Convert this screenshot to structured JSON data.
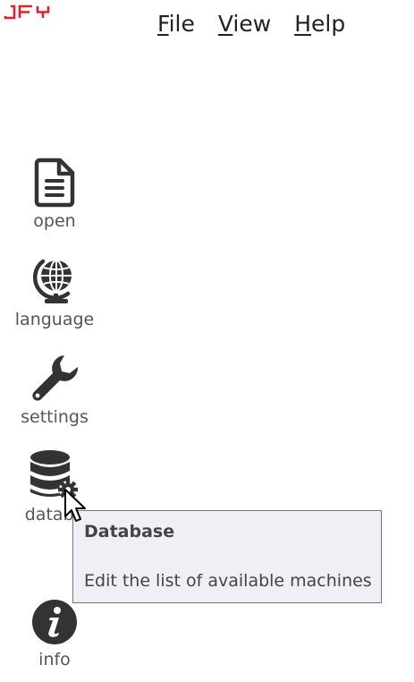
{
  "app": {
    "logo_text": "JFY",
    "brand_color": "#e4202b"
  },
  "menubar": {
    "items": [
      {
        "accel": "F",
        "rest": "ile"
      },
      {
        "accel": "V",
        "rest": "iew"
      },
      {
        "accel": "H",
        "rest": "elp"
      }
    ]
  },
  "sidebar": {
    "items": [
      {
        "label": "open",
        "icon": "file-document-icon"
      },
      {
        "label": "language",
        "icon": "globe-icon"
      },
      {
        "label": "settings",
        "icon": "wrench-icon"
      },
      {
        "label": "databa",
        "icon": "database-gear-icon"
      },
      {
        "label": "info",
        "icon": "info-icon"
      }
    ]
  },
  "tooltip": {
    "title": "Database",
    "body": "Edit the list of available machines"
  },
  "colors": {
    "icon": "#333333",
    "label": "#555555",
    "tooltip_bg": "#eff0f6",
    "tooltip_border": "#767676"
  }
}
